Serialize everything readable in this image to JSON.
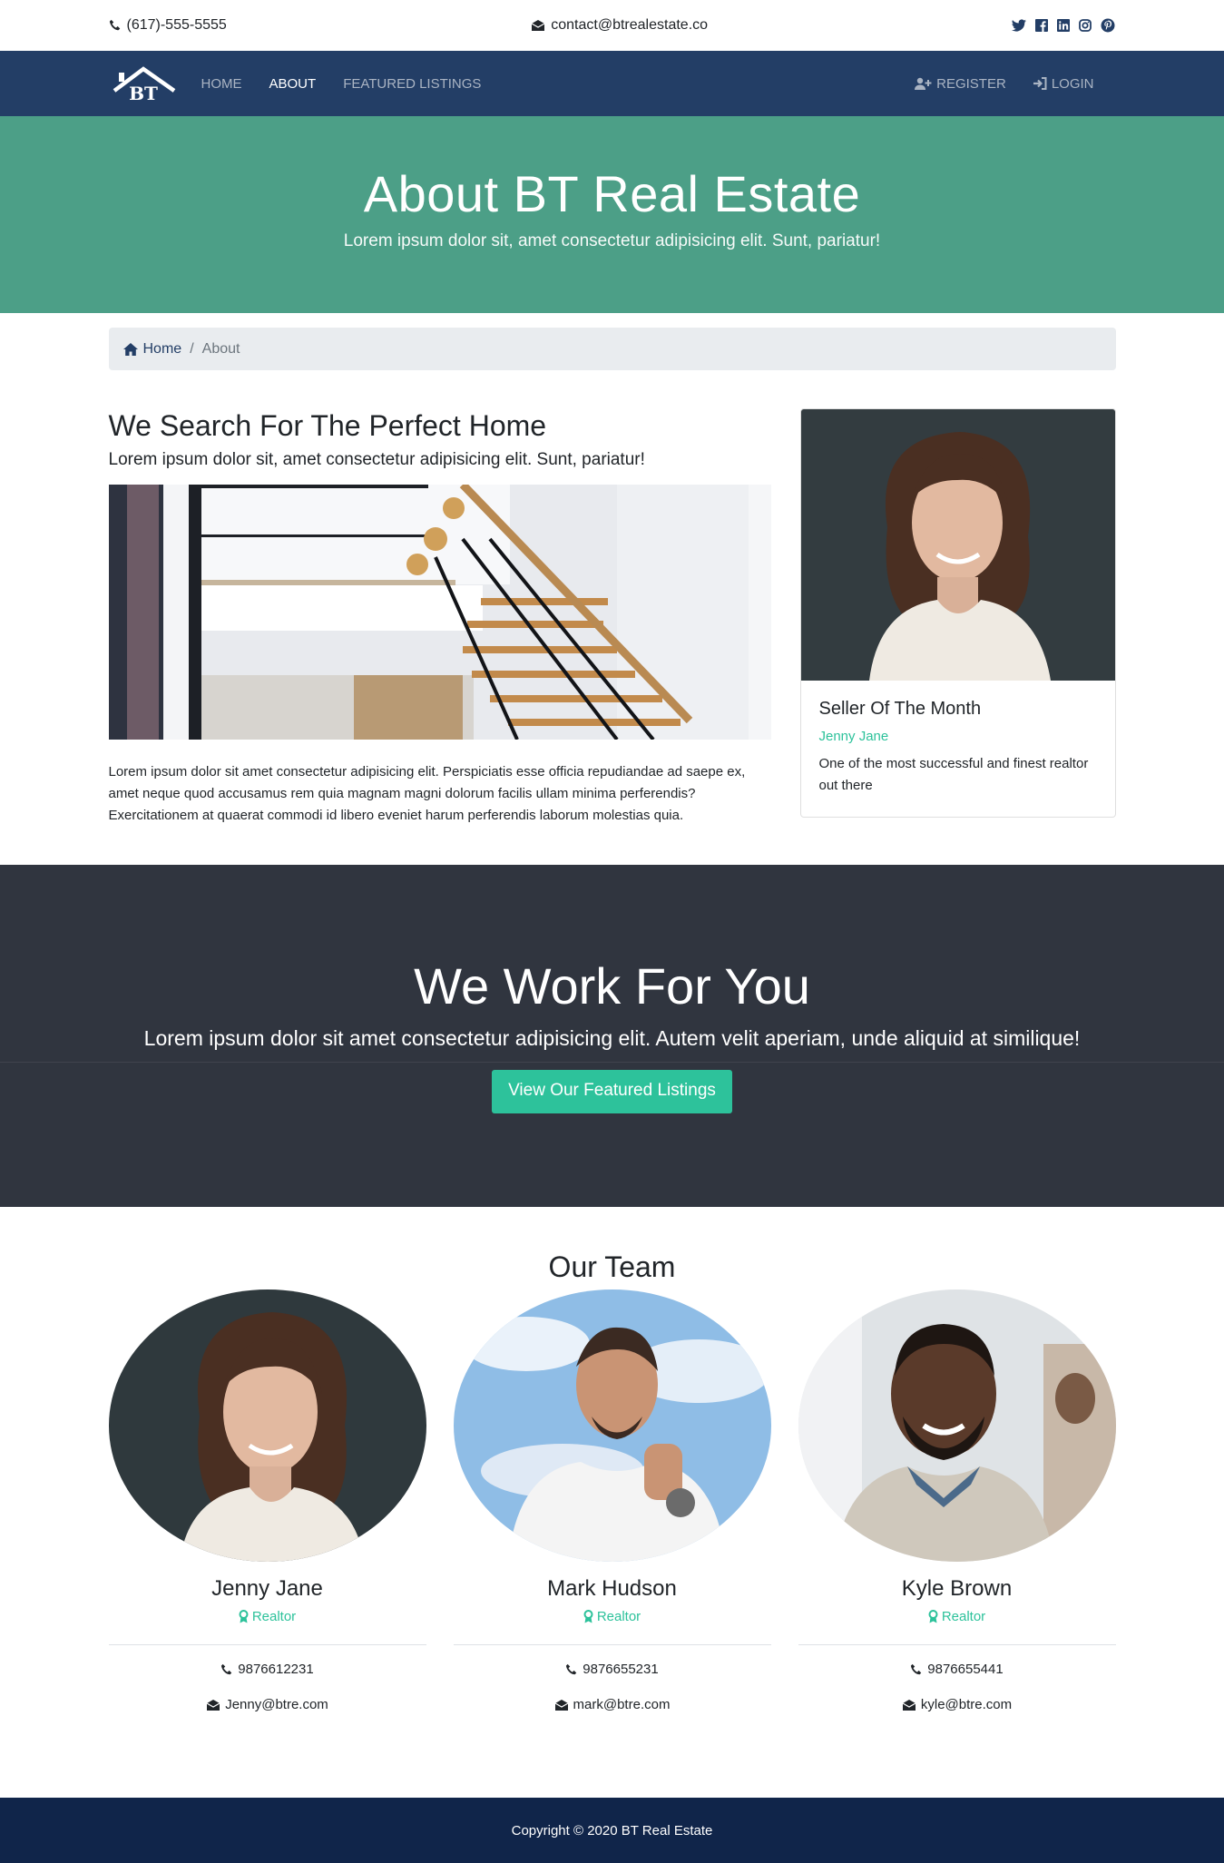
{
  "topbar": {
    "phone": "(617)-555-5555",
    "email": "contact@btrealestate.co",
    "social_icons": [
      "twitter-icon",
      "facebook-icon",
      "linkedin-icon",
      "instagram-icon",
      "pinterest-icon"
    ]
  },
  "nav": {
    "logo_text": "BT",
    "links": [
      "HOME",
      "ABOUT",
      "FEATURED LISTINGS"
    ],
    "active": "ABOUT",
    "register": "REGISTER",
    "login": "LOGIN"
  },
  "hero": {
    "title": "About BT Real Estate",
    "subtitle": "Lorem ipsum dolor sit, amet consectetur adipisicing elit. Sunt, pariatur!"
  },
  "breadcrumb": {
    "home": "Home",
    "current": "About"
  },
  "about": {
    "heading": "We Search For The Perfect Home",
    "lead": "Lorem ipsum dolor sit, amet consectetur adipisicing elit. Sunt, pariatur!",
    "body": "Lorem ipsum dolor sit amet consectetur adipisicing elit. Perspiciatis esse officia repudiandae ad saepe ex, amet neque quod accusamus rem quia magnam magni dolorum facilis ullam minima perferendis? Exercitationem at quaerat commodi id libero eveniet harum perferendis laborum molestias quia."
  },
  "seller": {
    "title": "Seller Of The Month",
    "name": "Jenny Jane",
    "description": "One of the most successful and finest realtor out there"
  },
  "work": {
    "title": "We Work For You",
    "text": "Lorem ipsum dolor sit amet consectetur adipisicing elit. Autem velit aperiam, unde aliquid at similique!",
    "button": "View Our Featured Listings"
  },
  "team": {
    "heading": "Our Team",
    "members": [
      {
        "name": "Jenny Jane",
        "role": "Realtor",
        "phone": "9876612231",
        "email": "Jenny@btre.com"
      },
      {
        "name": "Mark Hudson",
        "role": "Realtor",
        "phone": "9876655231",
        "email": "mark@btre.com"
      },
      {
        "name": "Kyle Brown",
        "role": "Realtor",
        "phone": "9876655441",
        "email": "kyle@btre.com"
      }
    ]
  },
  "footer": {
    "copyright": "Copyright © 2020 BT Real Estate"
  },
  "colors": {
    "navy": "#233e66",
    "green_band": "#4c9f87",
    "accent": "#2dc29b",
    "dark_band": "#30353f",
    "footer": "#10254a"
  }
}
